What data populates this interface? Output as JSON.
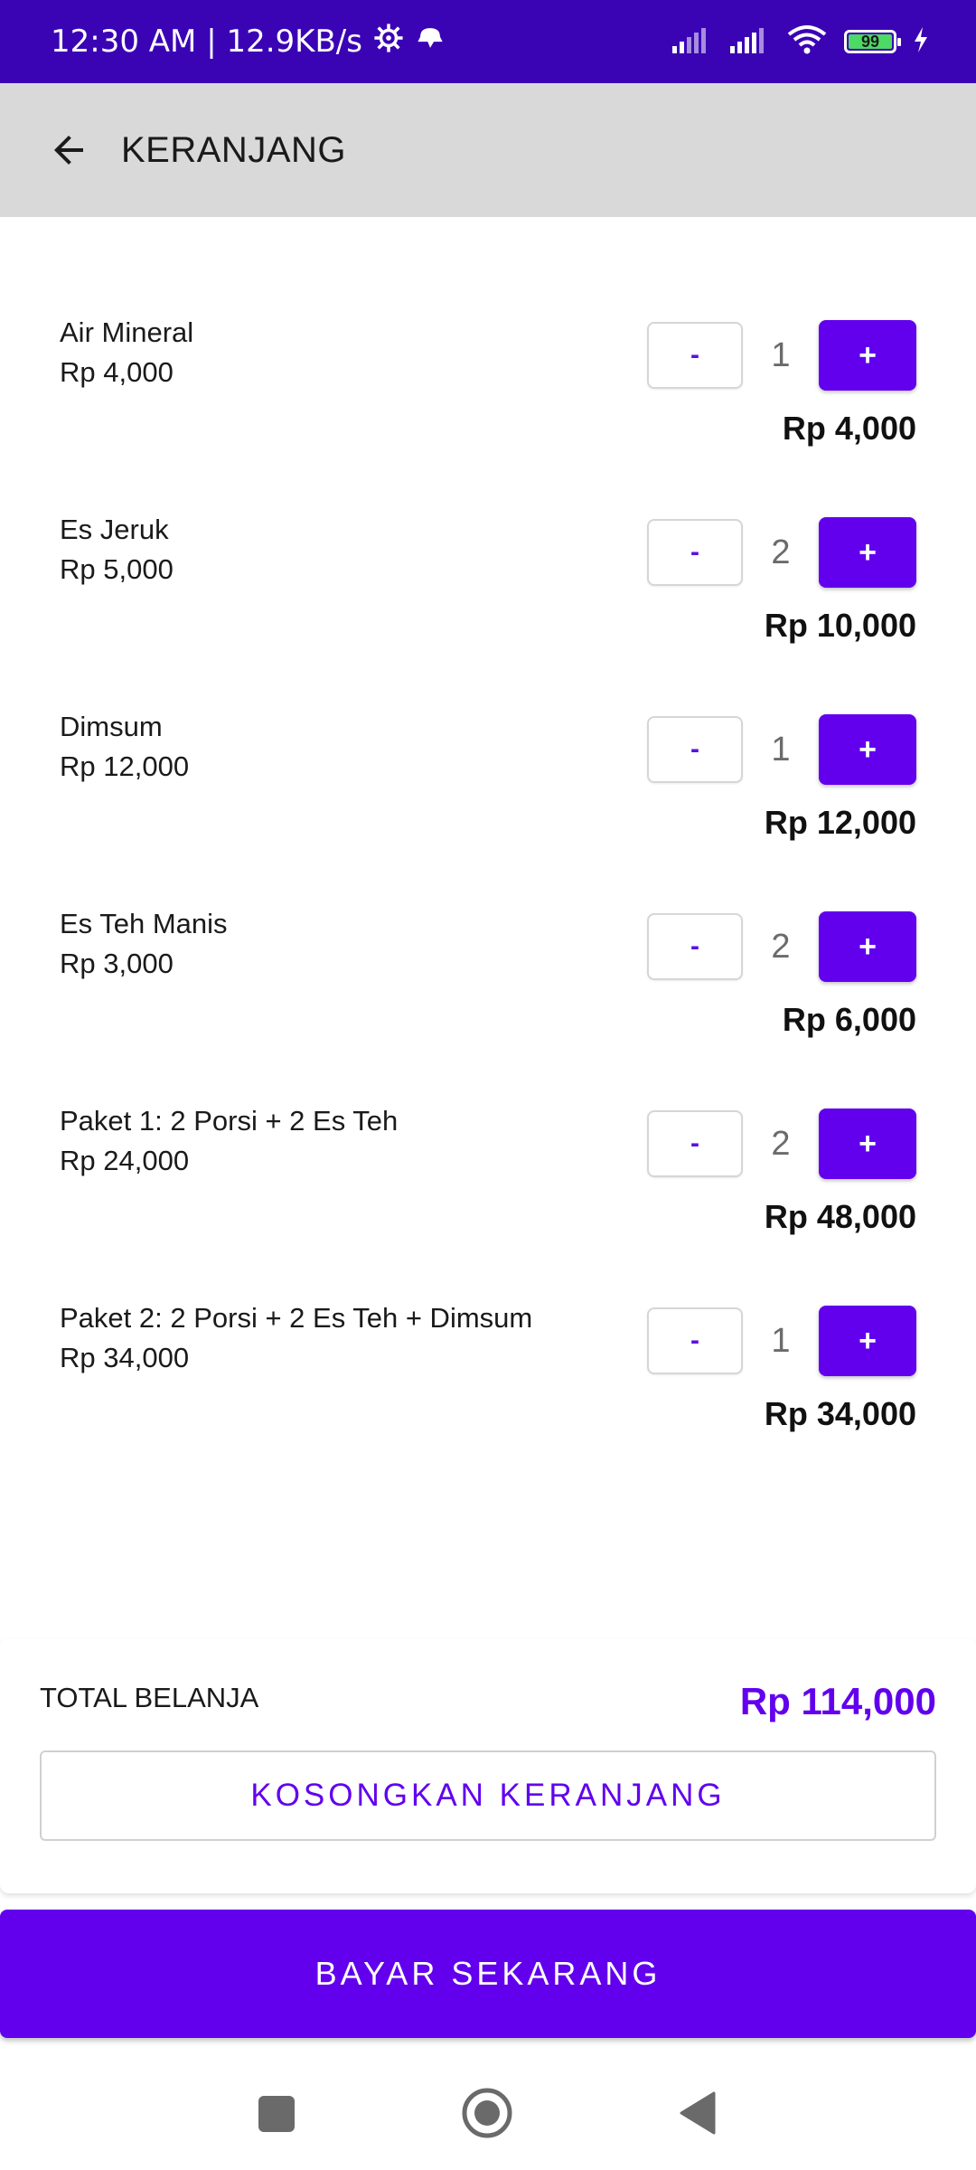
{
  "status_bar": {
    "time_info": "12:30 AM | 12.9KB/s",
    "battery_level": "99",
    "icons": [
      "settings-icon",
      "notification-icon",
      "signal-icon",
      "signal-icon-2",
      "wifi-icon",
      "battery-icon",
      "charging-icon"
    ]
  },
  "app_bar": {
    "title": "KERANJANG",
    "back_icon": "arrow-back-icon"
  },
  "cart": {
    "items": [
      {
        "name": "Air Mineral",
        "price": "Rp 4,000",
        "qty": "1",
        "subtotal": "Rp 4,000"
      },
      {
        "name": "Es Jeruk",
        "price": "Rp 5,000",
        "qty": "2",
        "subtotal": "Rp 10,000"
      },
      {
        "name": "Dimsum",
        "price": "Rp 12,000",
        "qty": "1",
        "subtotal": "Rp 12,000"
      },
      {
        "name": "Es Teh Manis",
        "price": "Rp 3,000",
        "qty": "2",
        "subtotal": "Rp 6,000"
      },
      {
        "name": "Paket 1: 2 Porsi + 2 Es Teh",
        "price": "Rp 24,000",
        "qty": "2",
        "subtotal": "Rp 48,000"
      },
      {
        "name": "Paket 2: 2 Porsi + 2 Es Teh + Dimsum",
        "price": "Rp 34,000",
        "qty": "1",
        "subtotal": "Rp 34,000"
      }
    ],
    "minus_label": "-",
    "plus_label": "+"
  },
  "summary": {
    "total_label": "TOTAL BELANJA",
    "total_value": "Rp 114,000",
    "clear_label": "KOSONGKAN KERANJANG"
  },
  "pay_label": "BAYAR SEKARANG",
  "colors": {
    "status_bar": "#3a04b5",
    "primary": "#6200ee",
    "app_bar": "#d9d9d9"
  }
}
